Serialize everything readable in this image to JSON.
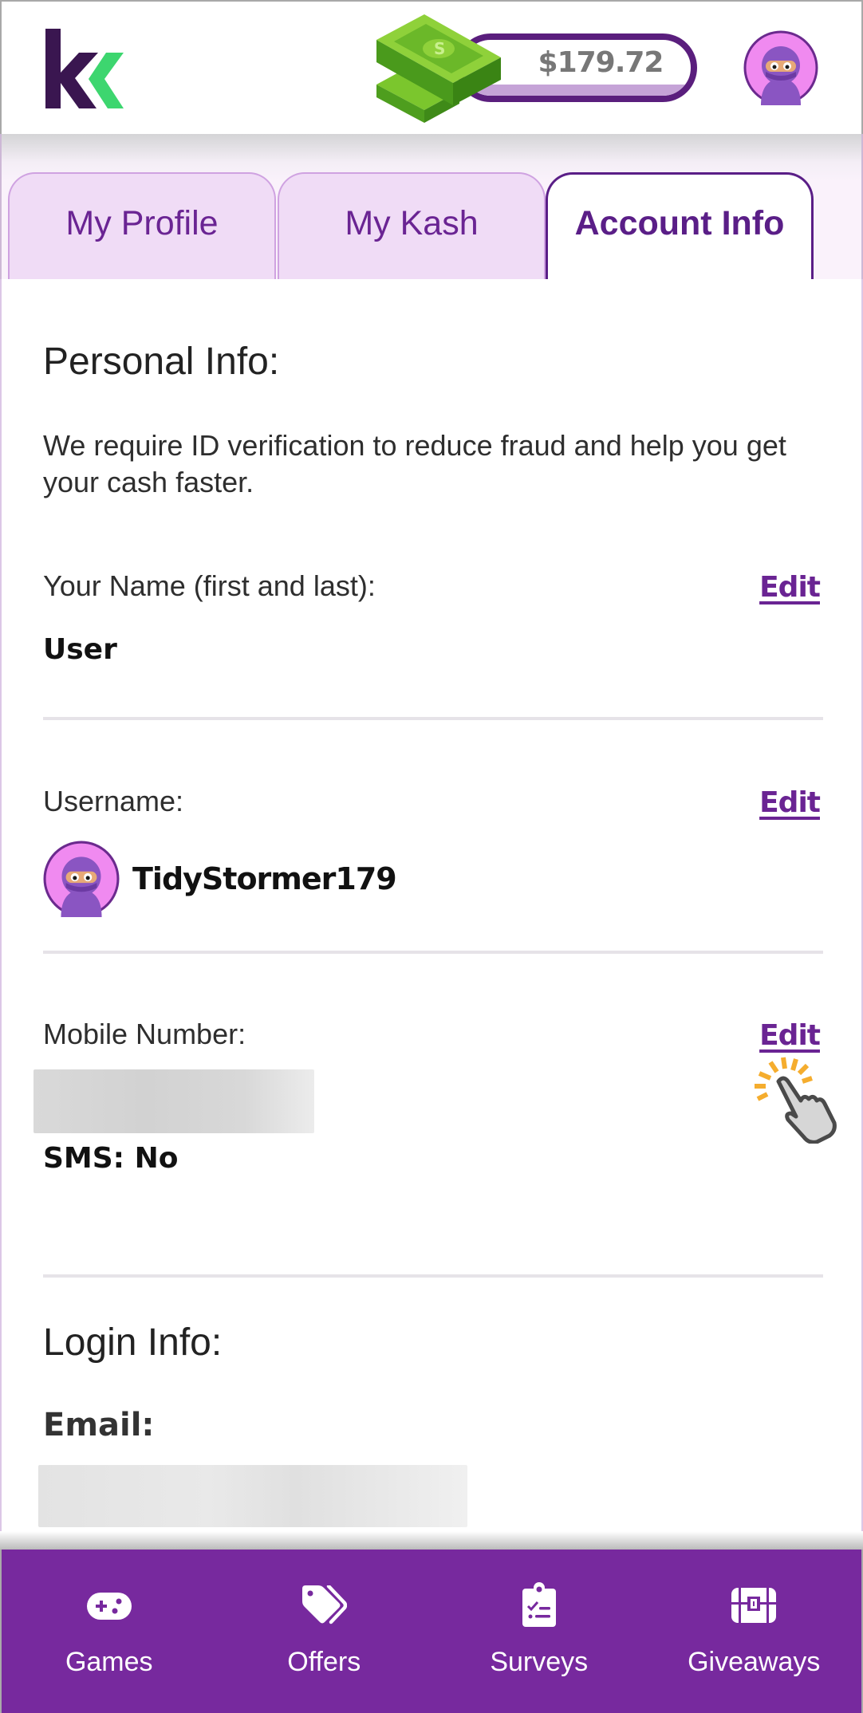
{
  "header": {
    "logo_alt": "Kashkick logo",
    "balance": "$179.72",
    "icons": {
      "money": "money-stack-icon",
      "avatar": "ninja-avatar"
    }
  },
  "tabs": [
    {
      "label": "My Profile",
      "active": false
    },
    {
      "label": "My Kash",
      "active": false
    },
    {
      "label": "Account Info",
      "active": true
    }
  ],
  "personal_info": {
    "title": "Personal Info:",
    "description": "We require ID verification to reduce fraud and help you get your cash faster.",
    "name": {
      "label": "Your Name (first and last):",
      "value": "User",
      "edit_label": "Edit"
    },
    "username": {
      "label": "Username:",
      "value": "TidyStormer179",
      "edit_label": "Edit"
    },
    "mobile": {
      "label": "Mobile Number:",
      "value_redacted": true,
      "sms_status": "SMS: No",
      "edit_label": "Edit"
    }
  },
  "login_info": {
    "title": "Login Info:",
    "email_label": "Email:",
    "email_redacted": true
  },
  "bottom_nav": [
    {
      "label": "Games",
      "icon": "gamepad-icon"
    },
    {
      "label": "Offers",
      "icon": "tags-icon"
    },
    {
      "label": "Surveys",
      "icon": "clipboard-check-icon"
    },
    {
      "label": "Giveaways",
      "icon": "treasure-chest-icon"
    }
  ],
  "colors": {
    "brand_purple": "#77299e",
    "accent_purple": "#6a2493",
    "logo_dark": "#3a1650",
    "logo_green": "#3dd66f",
    "tap_highlight": "#f5ad2e"
  }
}
